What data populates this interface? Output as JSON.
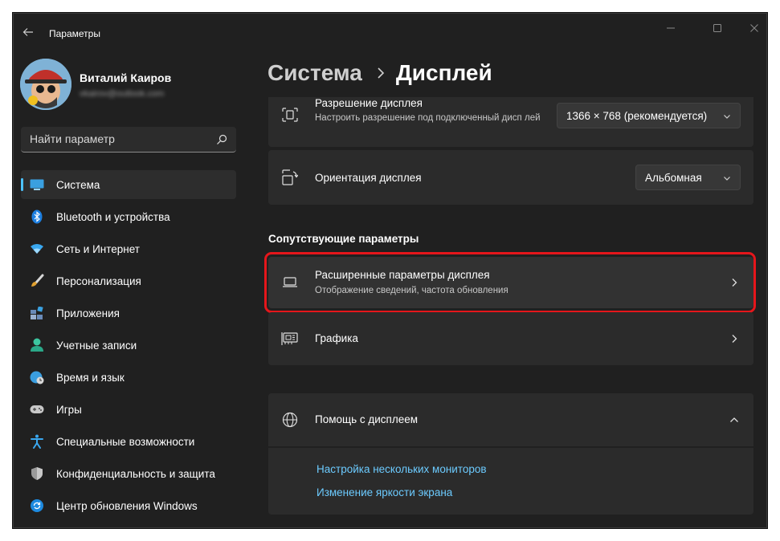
{
  "app": {
    "title": "Параметры"
  },
  "profile": {
    "name": "Виталий Каиров",
    "email": "vkairov@outlook.com"
  },
  "search": {
    "placeholder": "Найти параметр",
    "value": ""
  },
  "nav": {
    "items": [
      {
        "label": "Система",
        "icon": "system-icon",
        "selected": true
      },
      {
        "label": "Bluetooth и устройства",
        "icon": "bluetooth-icon"
      },
      {
        "label": "Сеть и Интернет",
        "icon": "wifi-icon"
      },
      {
        "label": "Персонализация",
        "icon": "brush-icon"
      },
      {
        "label": "Приложения",
        "icon": "apps-icon"
      },
      {
        "label": "Учетные записи",
        "icon": "account-icon"
      },
      {
        "label": "Время и язык",
        "icon": "clock-globe-icon"
      },
      {
        "label": "Игры",
        "icon": "gamepad-icon"
      },
      {
        "label": "Специальные возможности",
        "icon": "accessibility-icon"
      },
      {
        "label": "Конфиденциальность и защита",
        "icon": "shield-icon"
      },
      {
        "label": "Центр обновления Windows",
        "icon": "update-icon"
      }
    ]
  },
  "header": {
    "parent": "Система",
    "current": "Дисплей"
  },
  "settings": {
    "resolution": {
      "title": "Разрешение дисплея",
      "description": "Настроить разрешение под подключенный дисп лей",
      "value": "1366 × 768 (рекомендуется)"
    },
    "orientation": {
      "title": "Ориентация дисплея",
      "value": "Альбомная"
    }
  },
  "related": {
    "section_title": "Сопутствующие параметры",
    "advanced": {
      "title": "Расширенные параметры дисплея",
      "description": "Отображение сведений, частота обновления"
    },
    "graphics": {
      "title": "Графика"
    }
  },
  "help": {
    "title": "Помощь с дисплеем",
    "links": [
      "Настройка нескольких мониторов",
      "Изменение яркости экрана"
    ]
  },
  "colors": {
    "accent": "#4cc2ff",
    "link": "#6ccbff",
    "highlight": "#e5161b",
    "background": "#202020",
    "card": "#2b2b2b"
  }
}
